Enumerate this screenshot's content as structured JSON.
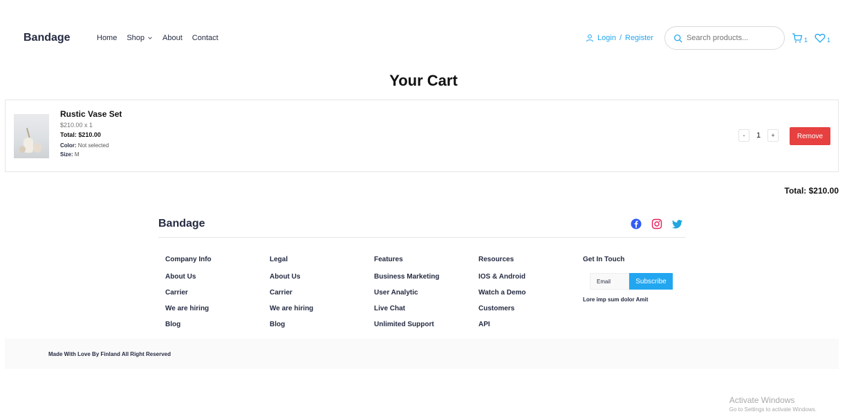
{
  "header": {
    "brand": "Bandage",
    "nav": {
      "home": "Home",
      "shop": "Shop",
      "about": "About",
      "contact": "Contact"
    },
    "auth": {
      "login": "Login",
      "separator": "/",
      "register": "Register"
    },
    "search_placeholder": "Search products...",
    "cart_count": "1",
    "wishlist_count": "1"
  },
  "page_title": "Your Cart",
  "cart": {
    "items": [
      {
        "name": "Rustic Vase Set",
        "price_line": "$210.00 x 1",
        "total_label": "Total:",
        "total_value": "$210.00",
        "color_label": "Color:",
        "color_value": "Not selected",
        "size_label": "Size:",
        "size_value": "M",
        "quantity": "1",
        "decrement": "-",
        "increment": "+",
        "remove_label": "Remove"
      }
    ],
    "grand_total": "Total: $210.00"
  },
  "footer": {
    "brand": "Bandage",
    "columns": [
      {
        "title": "Company Info",
        "links": [
          "About Us",
          "Carrier",
          "We are hiring",
          "Blog"
        ]
      },
      {
        "title": "Legal",
        "links": [
          "About Us",
          "Carrier",
          "We are hiring",
          "Blog"
        ]
      },
      {
        "title": "Features",
        "links": [
          "Business Marketing",
          "User Analytic",
          "Live Chat",
          "Unlimited Support"
        ]
      },
      {
        "title": "Resources",
        "links": [
          "IOS & Android",
          "Watch a Demo",
          "Customers",
          "API"
        ]
      }
    ],
    "get_in_touch": {
      "title": "Get In Touch",
      "email_placeholder": "Email",
      "subscribe_label": "Subscribe",
      "note": "Lore imp sum dolor Amit"
    },
    "copyright": "Made With Love By Finland All Right Reserved"
  },
  "watermark": {
    "line1": "Activate Windows",
    "line2": "Go to Settings to activate Windows."
  },
  "colors": {
    "primary": "#23A6F0",
    "danger": "#E74040",
    "text_dark": "#252B42",
    "muted": "#737373",
    "facebook": "#335BF5",
    "instagram": "#E51F5A",
    "twitter": "#21A6DF"
  }
}
